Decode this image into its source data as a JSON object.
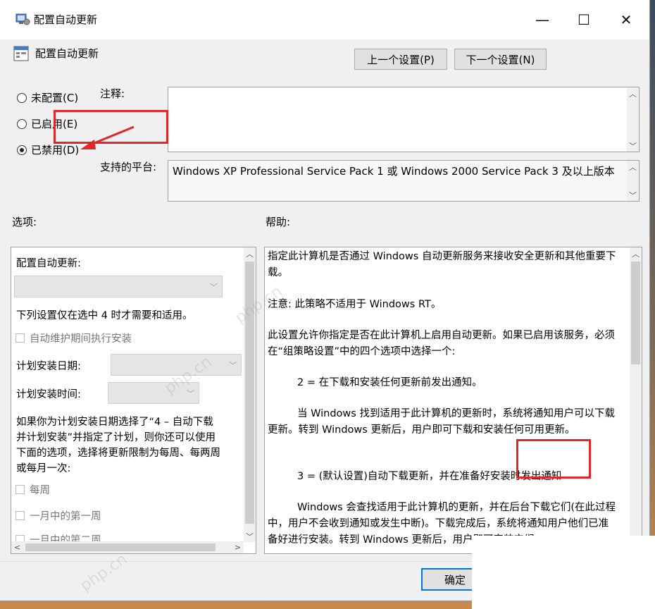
{
  "window": {
    "title": "配置自动更新",
    "minimize_glyph": "—",
    "maximize_glyph": "☐",
    "close_glyph": "✕"
  },
  "header": {
    "title": "配置自动更新",
    "prev_button": "上一个设置(P)",
    "next_button": "下一个设置(N)"
  },
  "state": {
    "options": [
      {
        "label": "未配置(C)",
        "selected": false
      },
      {
        "label": "已启用(E)",
        "selected": false
      },
      {
        "label": "已禁用(D)",
        "selected": true
      }
    ],
    "comment_label": "注释:",
    "comment_value": "",
    "platform_label": "支持的平台:",
    "platform_value": "Windows XP Professional Service Pack 1 或 Windows 2000 Service Pack 3 及以上版本"
  },
  "options_panel": {
    "label": "选项:",
    "configure_label": "配置自动更新:",
    "note": "下列设置仅在选中 4 时才需要和适用。",
    "auto_maintenance": "自动维护期间执行安装",
    "schedule_day_label": "计划安装日期:",
    "schedule_time_label": "计划安装时间:",
    "paragraph_lines": [
      "如果你为计划安装日期选择了“4 – 自动下载",
      "并计划安装”并指定了计划，则你还可以使用",
      "下面的选项，选择将更新限制为每周、每两周",
      "或每月一次:"
    ],
    "weekly": "每周",
    "first_week": "一月中的第一周",
    "second_week": "一月中的第二周"
  },
  "help_panel": {
    "label": "帮助:",
    "paragraphs": [
      "指定此计算机是否通过 Windows 自动更新服务来接收安全更新和其他重要下载。",
      "注意: 此策略不适用于 Windows RT。",
      "此设置允许你指定是否在此计算机上启用自动更新。如果已启用该服务，必须在“组策略设置”中的四个选项中选择一个:",
      "2 = 在下载和安装任何更新前发出通知。",
      "当 Windows 找到适用于此计算机的更新时，系统将通知用户可以下载更新。转到 Windows 更新后，用户即可下载和安装任何可用更新。",
      "3 = (默认设置)自动下载更新，并在准备好安装时发出通知",
      "Windows 会查找适用于此计算机的更新，并在后台下载它们(在此过程中，用户不会收到通知或发生中断)。下载完成后，系统将通知用户他们已准备好进行安装。转到 Windows 更新后，用户即可安装它们。"
    ]
  },
  "footer": {
    "ok_button": "确定"
  },
  "colors": {
    "annotation": "#e02828",
    "window_bg": "#f0f0f0"
  }
}
